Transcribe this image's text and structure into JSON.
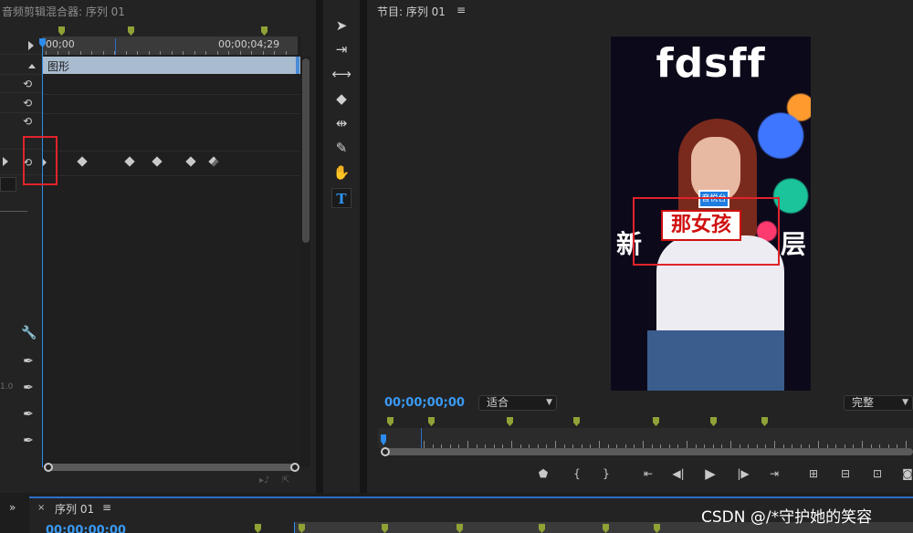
{
  "left_panel": {
    "tab_title": "音频剪辑混合器: 序列 01",
    "ruler_start": "00;00",
    "ruler_end": "00;00;04;29",
    "clip_label": "图形",
    "value_text": "1.0"
  },
  "monitor": {
    "tab_title": "节目: 序列 01",
    "menu_icon": "≡",
    "timecode": "00;00;00;00",
    "fit_label": "适合",
    "quality_label": "完整",
    "video": {
      "title_text": "fdsff",
      "mic_label": "音悦台",
      "side_text_left": "新",
      "side_text_right": "层",
      "caption": "那女孩"
    }
  },
  "bottom": {
    "expand_icon": "»",
    "close_icon": "×",
    "sequence_title": "序列 01",
    "menu_icon": "≡",
    "timecode": "00;00;00;00",
    "watermark": "CSDN @/*守护她的笑容"
  },
  "colors": {
    "accent_blue": "#2d8ceb",
    "marker_green": "#8ea236",
    "highlight_red": "#e0232b"
  }
}
